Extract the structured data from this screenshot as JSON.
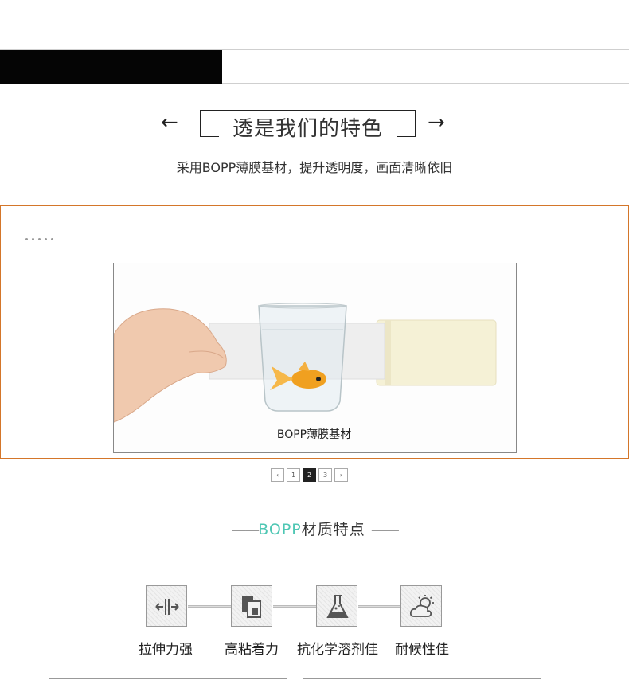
{
  "header": {
    "arrow_left": "←",
    "arrow_right": "→",
    "title": "透是我们的特色",
    "subtitle": "采用BOPP薄膜基材，提升透明度，画面清晰依旧"
  },
  "slider": {
    "caption": "BOPP薄膜基材",
    "accent_color": "#d4762a",
    "pagination": {
      "prev": "‹",
      "pages": [
        "1",
        "2",
        "3"
      ],
      "active_page": "2",
      "next": "›"
    }
  },
  "features": {
    "title_dash_left": "——",
    "title_accent": "BOPP",
    "title_rest": "材质特点",
    "title_dash_right": "——",
    "accent_color": "#4fc7b4",
    "items": [
      {
        "icon": "stretch-arrows-icon",
        "label": "拉伸力强"
      },
      {
        "icon": "adhesive-sheets-icon",
        "label": "高粘着力"
      },
      {
        "icon": "chemistry-flask-icon",
        "label": "抗化学溶剂佳"
      },
      {
        "icon": "weather-sun-cloud-icon",
        "label": "耐候性佳"
      }
    ]
  }
}
